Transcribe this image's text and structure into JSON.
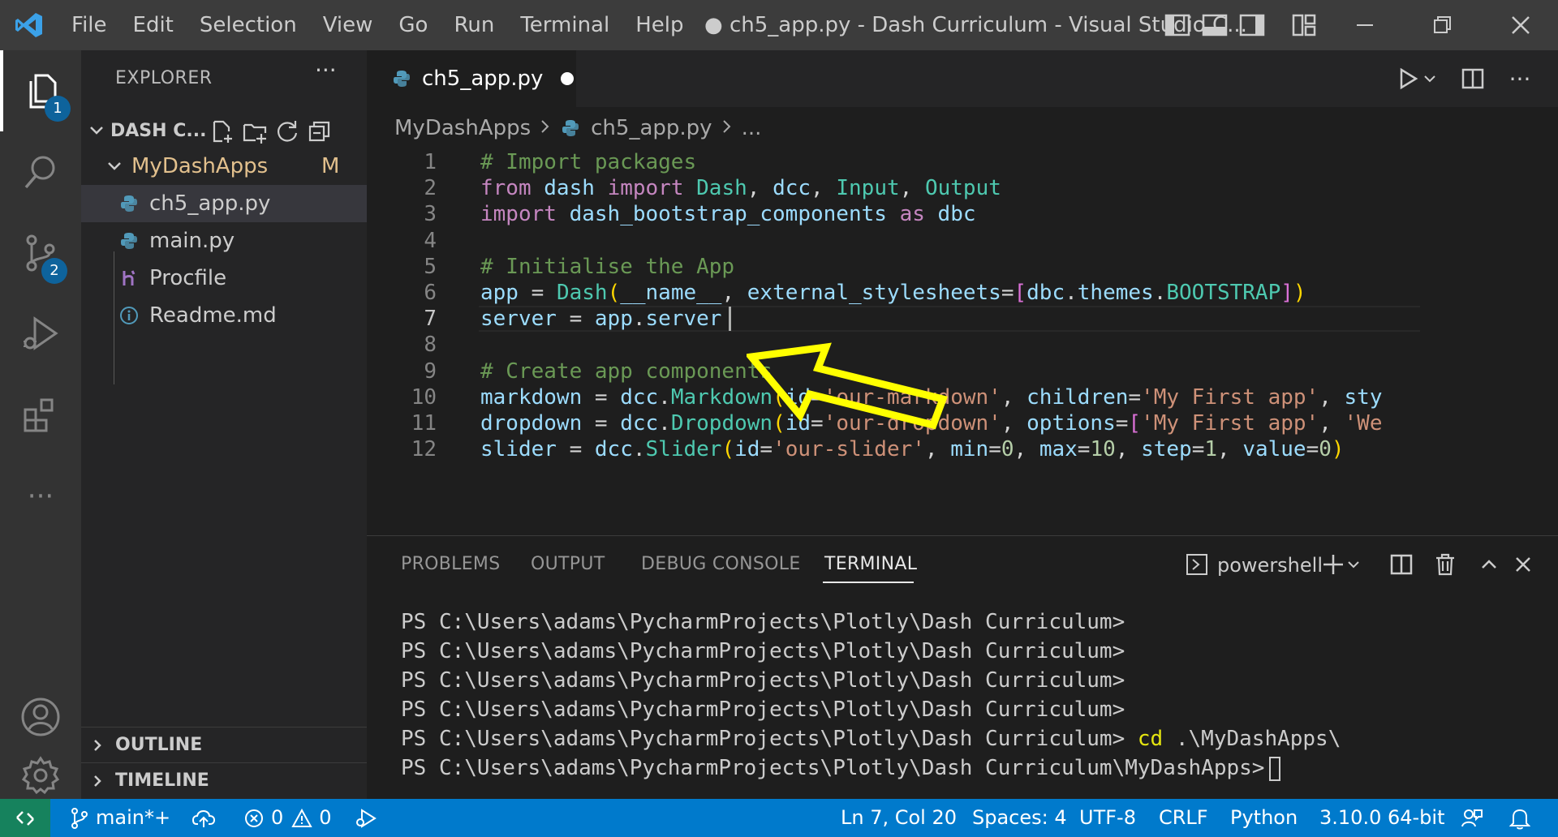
{
  "titlebar": {
    "menus": [
      "File",
      "Edit",
      "Selection",
      "View",
      "Go",
      "Run",
      "Terminal",
      "Help"
    ],
    "window_title": "● ch5_app.py - Dash Curriculum - Visual Studio C..."
  },
  "activitybar": {
    "explorer_badge": "1",
    "scm_badge": "2",
    "more": "···"
  },
  "sidebar": {
    "title": "EXPLORER",
    "more": "···",
    "folder": "DASH C...",
    "subfolder": "MyDashApps",
    "subfolder_status": "M",
    "files": [
      {
        "name": "ch5_app.py",
        "icon": "python-file-icon"
      },
      {
        "name": "main.py",
        "icon": "python-file-icon"
      },
      {
        "name": "Procfile",
        "icon": "heroku-file-icon"
      },
      {
        "name": "Readme.md",
        "icon": "info-file-icon"
      }
    ],
    "outline": "OUTLINE",
    "timeline": "TIMELINE"
  },
  "editor": {
    "tab_label": "ch5_app.py",
    "breadcrumb": [
      "MyDashApps",
      "ch5_app.py",
      "..."
    ],
    "current_line": 7,
    "lines": [
      {
        "n": "1",
        "text": "# Import packages"
      },
      {
        "n": "2",
        "text": "from dash import Dash, dcc, Input, Output"
      },
      {
        "n": "3",
        "text": "import dash_bootstrap_components as dbc"
      },
      {
        "n": "4",
        "text": ""
      },
      {
        "n": "5",
        "text": "# Initialise the App"
      },
      {
        "n": "6",
        "text": "app = Dash(__name__, external_stylesheets=[dbc.themes.BOOTSTRAP])"
      },
      {
        "n": "7",
        "text": "server = app.server"
      },
      {
        "n": "8",
        "text": ""
      },
      {
        "n": "9",
        "text": "# Create app components"
      },
      {
        "n": "10",
        "text": "markdown = dcc.Markdown(id='our-markdown', children='My First app', sty"
      },
      {
        "n": "11",
        "text": "dropdown = dcc.Dropdown(id='our-dropdown', options=['My First app', 'We"
      },
      {
        "n": "12",
        "text": "slider = dcc.Slider(id='our-slider', min=0, max=10, step=1, value=0)"
      }
    ]
  },
  "panel": {
    "tabs": [
      "PROBLEMS",
      "OUTPUT",
      "DEBUG CONSOLE",
      "TERMINAL"
    ],
    "active_tab": "TERMINAL",
    "shell": "powershell",
    "terminal": {
      "prompt": "PS C:\\Users\\adams\\PycharmProjects\\Plotly\\Dash Curriculum>",
      "command": "cd",
      "command_arg": " .\\MyDashApps\\",
      "last_prompt": "PS C:\\Users\\adams\\PycharmProjects\\Plotly\\Dash Curriculum\\MyDashApps>"
    }
  },
  "statusbar": {
    "branch": "main*+",
    "errors": "0",
    "warnings": "0",
    "position": "Ln 7, Col 20",
    "spaces": "Spaces: 4",
    "encoding": "UTF-8",
    "eol": "CRLF",
    "language": "Python",
    "interpreter": "3.10.0 64-bit"
  },
  "colors": {
    "accent": "#007acc",
    "remote": "#16825d",
    "annotation_arrow": "#ffff00"
  }
}
